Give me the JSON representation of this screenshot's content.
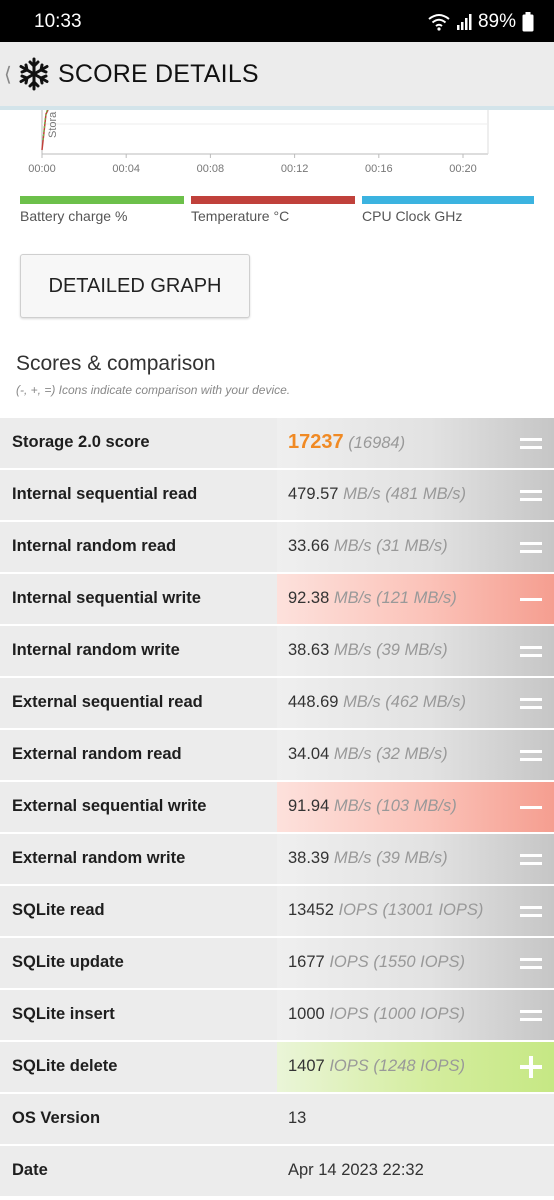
{
  "status_bar": {
    "time": "10:33",
    "battery": "89%"
  },
  "header": {
    "back_icon": "chevron-left",
    "logo_icon": "snowflake-icon",
    "title": "SCORE DETAILS"
  },
  "graph": {
    "y_label_fragment": "Stora",
    "x_ticks": [
      "00:00",
      "00:04",
      "00:08",
      "00:12",
      "00:16",
      "00:20"
    ],
    "legend": [
      {
        "label": "Battery charge %",
        "color": "#6cc04a"
      },
      {
        "label": "Temperature °C",
        "color": "#c0413b"
      },
      {
        "label": "CPU Clock GHz",
        "color": "#3bb3e0"
      }
    ]
  },
  "detailed_graph_button": "DETAILED GRAPH",
  "scores_section": {
    "title": "Scores & comparison",
    "subtitle": "(-, +, =) Icons indicate comparison with your device."
  },
  "score_rows": [
    {
      "label": "Storage 2.0 score",
      "value": "17237",
      "unit": "",
      "comparison": "(16984)",
      "indicator": "equal",
      "is_score": true
    },
    {
      "label": "Internal sequential read",
      "value": "479.57",
      "unit": "MB/s",
      "comparison": "(481 MB/s)",
      "indicator": "equal"
    },
    {
      "label": "Internal random read",
      "value": "33.66",
      "unit": "MB/s",
      "comparison": "(31 MB/s)",
      "indicator": "equal"
    },
    {
      "label": "Internal sequential write",
      "value": "92.38",
      "unit": "MB/s",
      "comparison": "(121 MB/s)",
      "indicator": "minus"
    },
    {
      "label": "Internal random write",
      "value": "38.63",
      "unit": "MB/s",
      "comparison": "(39 MB/s)",
      "indicator": "equal"
    },
    {
      "label": "External sequential read",
      "value": "448.69",
      "unit": "MB/s",
      "comparison": "(462 MB/s)",
      "indicator": "equal"
    },
    {
      "label": "External random read",
      "value": "34.04",
      "unit": "MB/s",
      "comparison": "(32 MB/s)",
      "indicator": "equal"
    },
    {
      "label": "External sequential write",
      "value": "91.94",
      "unit": "MB/s",
      "comparison": "(103 MB/s)",
      "indicator": "minus"
    },
    {
      "label": "External random write",
      "value": "38.39",
      "unit": "MB/s",
      "comparison": "(39 MB/s)",
      "indicator": "equal"
    },
    {
      "label": "SQLite read",
      "value": "13452",
      "unit": "IOPS",
      "comparison": "(13001 IOPS)",
      "indicator": "equal"
    },
    {
      "label": "SQLite update",
      "value": "1677",
      "unit": "IOPS",
      "comparison": "(1550 IOPS)",
      "indicator": "equal"
    },
    {
      "label": "SQLite insert",
      "value": "1000",
      "unit": "IOPS",
      "comparison": "(1000 IOPS)",
      "indicator": "equal"
    },
    {
      "label": "SQLite delete",
      "value": "1407",
      "unit": "IOPS",
      "comparison": "(1248 IOPS)",
      "indicator": "plus"
    }
  ],
  "info_rows": [
    {
      "label": "OS Version",
      "value": "13"
    },
    {
      "label": "Date",
      "value": "Apr 14 2023 22:32"
    }
  ]
}
